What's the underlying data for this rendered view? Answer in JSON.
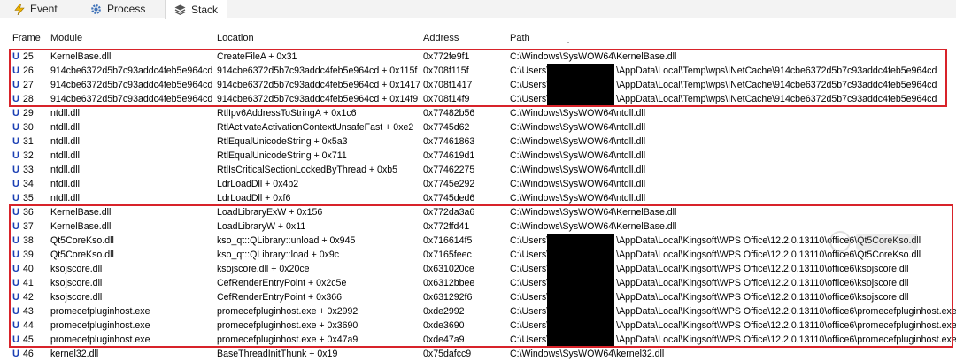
{
  "tabs": [
    {
      "label": "Event",
      "icon": "lightning-icon"
    },
    {
      "label": "Process",
      "icon": "gear-icon"
    },
    {
      "label": "Stack",
      "icon": "layers-icon",
      "active": true
    }
  ],
  "columns": [
    "Frame",
    "Module",
    "Location",
    "Address",
    "Path"
  ],
  "rows": [
    {
      "frame": "25",
      "module": "KernelBase.dll",
      "location": "CreateFileA + 0x31",
      "address": "0x772fe9f1",
      "path": "C:\\Windows\\SysWOW64\\KernelBase.dll"
    },
    {
      "frame": "26",
      "module": "914cbe6372d5b7c93addc4feb5e964cd",
      "location": "914cbe6372d5b7c93addc4feb5e964cd + 0x115f",
      "address": "0x708f115f",
      "path_pre": "C:\\Users\\",
      "path_post": "\\AppData\\Local\\Temp\\wps\\INetCache\\914cbe6372d5b7c93addc4feb5e964cd"
    },
    {
      "frame": "27",
      "module": "914cbe6372d5b7c93addc4feb5e964cd",
      "location": "914cbe6372d5b7c93addc4feb5e964cd + 0x1417",
      "address": "0x708f1417",
      "path_pre": "C:\\Users\\",
      "path_post": "\\AppData\\Local\\Temp\\wps\\INetCache\\914cbe6372d5b7c93addc4feb5e964cd"
    },
    {
      "frame": "28",
      "module": "914cbe6372d5b7c93addc4feb5e964cd",
      "location": "914cbe6372d5b7c93addc4feb5e964cd + 0x14f9",
      "address": "0x708f14f9",
      "path_pre": "C:\\Users\\",
      "path_post": "\\AppData\\Local\\Temp\\wps\\INetCache\\914cbe6372d5b7c93addc4feb5e964cd"
    },
    {
      "frame": "29",
      "module": "ntdll.dll",
      "location": "RtlIpv6AddressToStringA + 0x1c6",
      "address": "0x77482b56",
      "path": "C:\\Windows\\SysWOW64\\ntdll.dll"
    },
    {
      "frame": "30",
      "module": "ntdll.dll",
      "location": "RtlActivateActivationContextUnsafeFast + 0xe2",
      "address": "0x7745d62",
      "path": "C:\\Windows\\SysWOW64\\ntdll.dll"
    },
    {
      "frame": "31",
      "module": "ntdll.dll",
      "location": "RtlEqualUnicodeString + 0x5a3",
      "address": "0x77461863",
      "path": "C:\\Windows\\SysWOW64\\ntdll.dll"
    },
    {
      "frame": "32",
      "module": "ntdll.dll",
      "location": "RtlEqualUnicodeString + 0x711",
      "address": "0x774619d1",
      "path": "C:\\Windows\\SysWOW64\\ntdll.dll"
    },
    {
      "frame": "33",
      "module": "ntdll.dll",
      "location": "RtlIsCriticalSectionLockedByThread + 0xb5",
      "address": "0x77462275",
      "path": "C:\\Windows\\SysWOW64\\ntdll.dll"
    },
    {
      "frame": "34",
      "module": "ntdll.dll",
      "location": "LdrLoadDll + 0x4b2",
      "address": "0x7745e292",
      "path": "C:\\Windows\\SysWOW64\\ntdll.dll"
    },
    {
      "frame": "35",
      "module": "ntdll.dll",
      "location": "LdrLoadDll + 0xf6",
      "address": "0x7745ded6",
      "path": "C:\\Windows\\SysWOW64\\ntdll.dll"
    },
    {
      "frame": "36",
      "module": "KernelBase.dll",
      "location": "LoadLibraryExW + 0x156",
      "address": "0x772da3a6",
      "path": "C:\\Windows\\SysWOW64\\KernelBase.dll"
    },
    {
      "frame": "37",
      "module": "KernelBase.dll",
      "location": "LoadLibraryW + 0x11",
      "address": "0x772ffd41",
      "path": "C:\\Windows\\SysWOW64\\KernelBase.dll"
    },
    {
      "frame": "38",
      "module": "Qt5CoreKso.dll",
      "location": "kso_qt::QLibrary::unload + 0x945",
      "address": "0x716614f5",
      "path_pre": "C:\\Users\\",
      "path_post": "\\AppData\\Local\\Kingsoft\\WPS Office\\12.2.0.13110\\office6\\Qt5CoreKso.dll"
    },
    {
      "frame": "39",
      "module": "Qt5CoreKso.dll",
      "location": "kso_qt::QLibrary::load + 0x9c",
      "address": "0x7165feec",
      "path_pre": "C:\\Users\\",
      "path_post": "\\AppData\\Local\\Kingsoft\\WPS Office\\12.2.0.13110\\office6\\Qt5CoreKso.dll"
    },
    {
      "frame": "40",
      "module": "ksojscore.dll",
      "location": "ksojscore.dll + 0x20ce",
      "address": "0x631020ce",
      "path_pre": "C:\\Users\\",
      "path_post": "\\AppData\\Local\\Kingsoft\\WPS Office\\12.2.0.13110\\office6\\ksojscore.dll"
    },
    {
      "frame": "41",
      "module": "ksojscore.dll",
      "location": "CefRenderEntryPoint + 0x2c5e",
      "address": "0x6312bbee",
      "path_pre": "C:\\Users\\",
      "path_post": "\\AppData\\Local\\Kingsoft\\WPS Office\\12.2.0.13110\\office6\\ksojscore.dll"
    },
    {
      "frame": "42",
      "module": "ksojscore.dll",
      "location": "CefRenderEntryPoint + 0x366",
      "address": "0x631292f6",
      "path_pre": "C:\\Users\\",
      "path_post": "\\AppData\\Local\\Kingsoft\\WPS Office\\12.2.0.13110\\office6\\ksojscore.dll"
    },
    {
      "frame": "43",
      "module": "promecefpluginhost.exe",
      "location": "promecefpluginhost.exe + 0x2992",
      "address": "0xde2992",
      "path_pre": "C:\\Users\\",
      "path_post": "\\AppData\\Local\\Kingsoft\\WPS Office\\12.2.0.13110\\office6\\promecefpluginhost.exe"
    },
    {
      "frame": "44",
      "module": "promecefpluginhost.exe",
      "location": "promecefpluginhost.exe + 0x3690",
      "address": "0xde3690",
      "path_pre": "C:\\Users\\",
      "path_post": "\\AppData\\Local\\Kingsoft\\WPS Office\\12.2.0.13110\\office6\\promecefpluginhost.exe"
    },
    {
      "frame": "45",
      "module": "promecefpluginhost.exe",
      "location": "promecefpluginhost.exe + 0x47a9",
      "address": "0xde47a9",
      "path_pre": "C:\\Users\\",
      "path_post": "\\AppData\\Local\\Kingsoft\\WPS Office\\12.2.0.13110\\office6\\promecefpluginhost.exe"
    },
    {
      "frame": "46",
      "module": "kernel32.dll",
      "location": "BaseThreadInitThunk + 0x19",
      "address": "0x75dafcc9",
      "path": "C:\\Windows\\SysWOW64\\kernel32.dll"
    }
  ],
  "frame_prefix": "U",
  "colors": {
    "user_mode": "#1a3fb3",
    "highlight": "#d8232a",
    "redaction": "#000000"
  }
}
